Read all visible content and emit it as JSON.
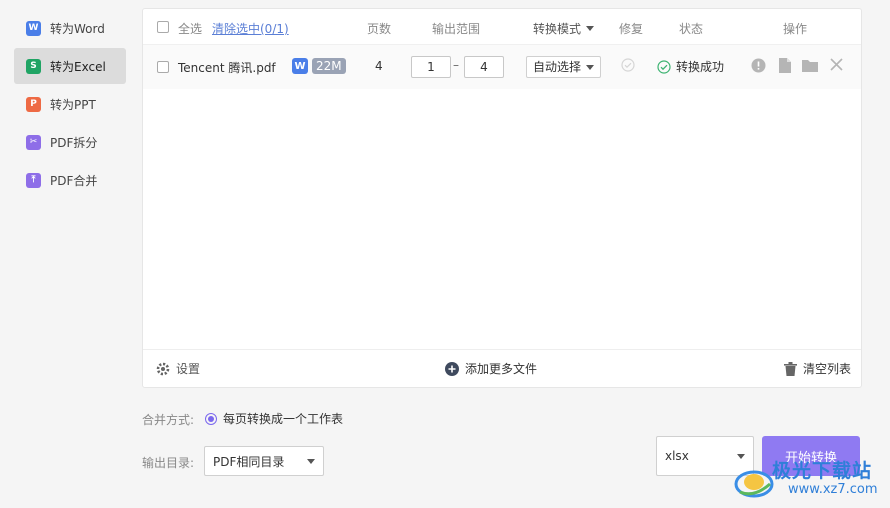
{
  "sidebar": {
    "items": [
      {
        "label": "转为Word",
        "icon": "word-icon",
        "icon_glyph": "W",
        "color": "#4a7ee8",
        "active": false
      },
      {
        "label": "转为Excel",
        "icon": "excel-icon",
        "icon_glyph": "S",
        "color": "#20a464",
        "active": true
      },
      {
        "label": "转为PPT",
        "icon": "ppt-icon",
        "icon_glyph": "P",
        "color": "#ee6a44",
        "active": false
      },
      {
        "label": "PDF拆分",
        "icon": "split-icon",
        "icon_glyph": "✂",
        "color": "#8e6ee8",
        "active": false
      },
      {
        "label": "PDF合并",
        "icon": "merge-icon",
        "icon_glyph": "⤒",
        "color": "#8e6ee8",
        "active": false
      }
    ]
  },
  "table": {
    "headers": {
      "select_all": "全选",
      "clear_selected": "清除选中(0/1)",
      "pages": "页数",
      "output_range": "输出范围",
      "convert_mode": "转换模式",
      "repair": "修复",
      "status": "状态",
      "actions": "操作"
    },
    "rows": [
      {
        "filename": "Tencent 腾讯.pdf",
        "format_badge": "W",
        "size": "22M",
        "pages": "4",
        "range_from": "1",
        "range_sep": "–",
        "range_to": "4",
        "mode": "自动选择",
        "status": "转换成功"
      }
    ]
  },
  "footer": {
    "settings": "设置",
    "add_more": "添加更多文件",
    "clear_list": "清空列表"
  },
  "options": {
    "merge_label": "合并方式:",
    "merge_value": "每页转换成一个工作表",
    "output_dir_label": "输出目录:",
    "output_dir_value": "PDF相同目录",
    "format_value": "xlsx",
    "start_button": "开始转换"
  },
  "watermark": {
    "text": "极光下载站",
    "url": "www.xz7.com"
  },
  "colors": {
    "accent": "#8f7af2",
    "success": "#3cb371",
    "link": "#5b7fd6"
  }
}
